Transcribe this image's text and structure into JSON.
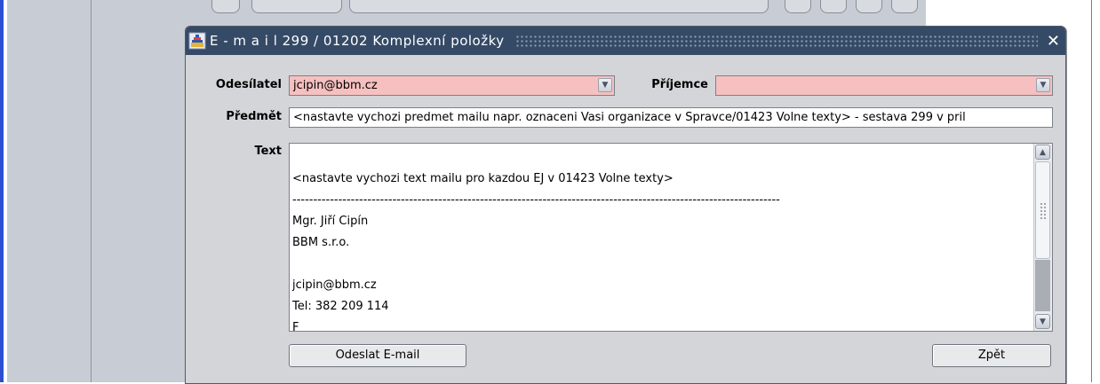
{
  "window": {
    "title": "E - m a i l   299 / 01202 Komplexní položky",
    "close_label": "✕"
  },
  "form": {
    "sender_label": "Odesílatel",
    "sender_value": "jcipin@bbm.cz",
    "recipient_label": "Příjemce",
    "recipient_value": "",
    "subject_label": "Předmět",
    "subject_value": "<nastavte vychozi predmet mailu napr. oznaceni Vasi organizace v Spravce/01423 Volne texty> - sestava 299 v pril",
    "text_label": "Text",
    "text_lines": [
      "",
      "<nastavte vychozi text mailu pro kazdou EJ v 01423 Volne texty>",
      "---------------------------------------------------------------------------------------------------------------------",
      "Mgr. Jiří Cipín",
      "BBM s.r.o.",
      "",
      "jcipin@bbm.cz",
      "Tel: 382 209 114",
      "F"
    ]
  },
  "buttons": {
    "send": "Odeslat E-mail",
    "back": "Zpět"
  },
  "colors": {
    "titlebar": "#354a66",
    "required_field": "#f6c0c0",
    "dialog_bg": "#d4d5d8"
  },
  "icons": {
    "app": "oracle-forms-icon",
    "close": "close-icon",
    "dropdown": "chevron-down-icon"
  }
}
